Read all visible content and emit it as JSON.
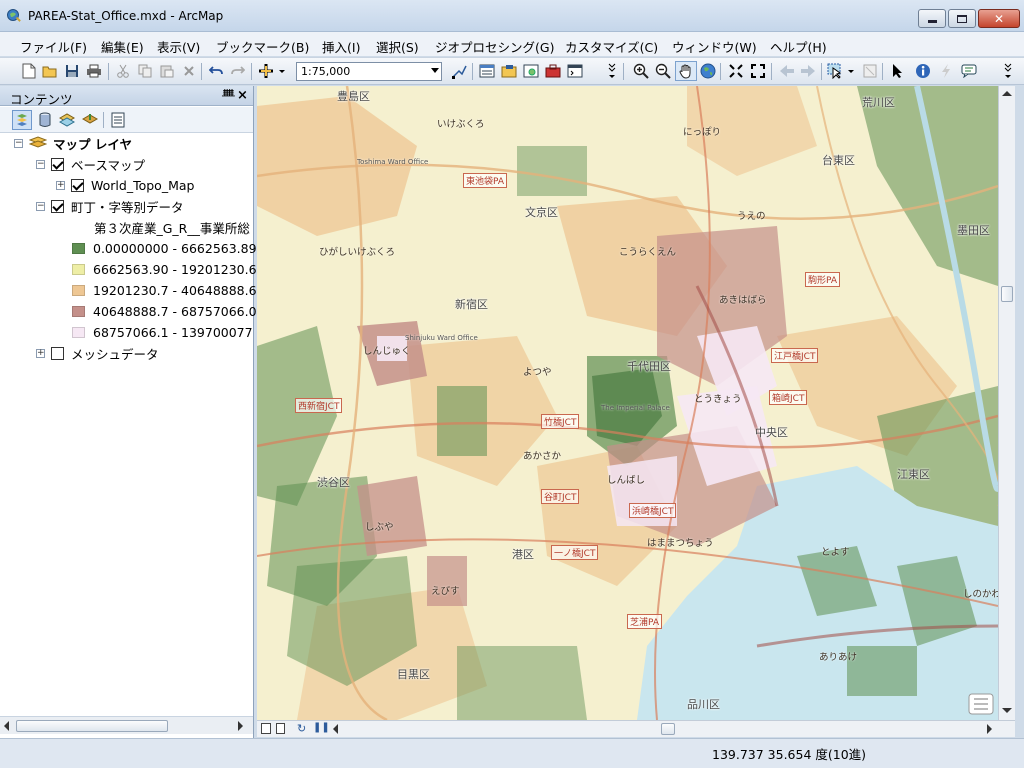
{
  "window": {
    "title": "PAREA-Stat_Office.mxd - ArcMap",
    "min_glyph": "─",
    "max_glyph": "□",
    "close_glyph": "✕"
  },
  "menu": [
    "ファイル(F)",
    "編集(E)",
    "表示(V)",
    "ブックマーク(B)",
    "挿入(I)",
    "選択(S)",
    "ジオプロセシング(G)",
    "カスタマイズ(C)",
    "ウィンドウ(W)",
    "ヘルプ(H)"
  ],
  "toolbar": {
    "scale": "1:75,000"
  },
  "toc": {
    "title": "コンテンツ",
    "pin": "ᚙ",
    "close": "×",
    "root": "マップ レイヤ",
    "basemap_group": "ベースマップ",
    "basemap_layer": "World_Topo_Map",
    "data_layer": "町丁・字等別データ",
    "field": "第３次産業_G_R__事業所総",
    "classes": [
      {
        "label": "0.00000000 - 6662563.89",
        "color": "#5f8f52"
      },
      {
        "label": "6662563.90 - 19201230.6",
        "color": "#eeeea6"
      },
      {
        "label": "19201230.7 - 40648888.6",
        "color": "#eec794"
      },
      {
        "label": "40648888.7 - 68757066.0",
        "color": "#c4908a"
      },
      {
        "label": "68757066.1 - 139700077",
        "color": "#f6e8f4"
      }
    ],
    "mesh_layer": "メッシュデータ"
  },
  "map": {
    "labels": [
      {
        "text": "豊島区",
        "cls": "ml-ward"
      },
      {
        "text": "Toshima Ward Office",
        "cls": "ml-sub"
      },
      {
        "text": "文京区",
        "cls": "ml-ward"
      },
      {
        "text": "荒川区",
        "cls": "ml-ward"
      },
      {
        "text": "台東区",
        "cls": "ml-ward"
      },
      {
        "text": "墨田区",
        "cls": "ml-ward"
      },
      {
        "text": "新宿区",
        "cls": "ml-ward"
      },
      {
        "text": "Shinjuku Ward Office",
        "cls": "ml-sub"
      },
      {
        "text": "千代田区",
        "cls": "ml-ward"
      },
      {
        "text": "中央区",
        "cls": "ml-ward"
      },
      {
        "text": "江東区",
        "cls": "ml-ward"
      },
      {
        "text": "渋谷区",
        "cls": "ml-ward"
      },
      {
        "text": "港区",
        "cls": "ml-ward"
      },
      {
        "text": "目黒区",
        "cls": "ml-ward"
      },
      {
        "text": "品川区",
        "cls": "ml-ward"
      },
      {
        "text": "いけぶくろ",
        "cls": "ml-kana"
      },
      {
        "text": "しんじゅく",
        "cls": "ml-kana"
      },
      {
        "text": "しぶや",
        "cls": "ml-kana"
      },
      {
        "text": "あきはばら",
        "cls": "ml-kana"
      },
      {
        "text": "とうきょう",
        "cls": "ml-kana"
      },
      {
        "text": "うえの",
        "cls": "ml-kana"
      },
      {
        "text": "しんばし",
        "cls": "ml-kana"
      },
      {
        "text": "はままつちょう",
        "cls": "ml-kana"
      },
      {
        "text": "ひがしいけぶくろ",
        "cls": "ml-kana"
      },
      {
        "text": "にっぽり",
        "cls": "ml-kana"
      },
      {
        "text": "こうらくえん",
        "cls": "ml-kana"
      },
      {
        "text": "よつや",
        "cls": "ml-kana"
      },
      {
        "text": "あかさか",
        "cls": "ml-kana"
      },
      {
        "text": "えびす",
        "cls": "ml-kana"
      },
      {
        "text": "とよす",
        "cls": "ml-kana"
      },
      {
        "text": "ありあけ",
        "cls": "ml-kana"
      },
      {
        "text": "しのかわ",
        "cls": "ml-kana"
      },
      {
        "text": "The Imperial Palace",
        "cls": "ml-sub"
      },
      {
        "text": "竹橋JCT",
        "cls": "ml-jct"
      },
      {
        "text": "江戸橋JCT",
        "cls": "ml-jct"
      },
      {
        "text": "箱崎JCT",
        "cls": "ml-jct"
      },
      {
        "text": "西新宿JCT",
        "cls": "ml-jct"
      },
      {
        "text": "谷町JCT",
        "cls": "ml-jct"
      },
      {
        "text": "浜崎橋JCT",
        "cls": "ml-jct"
      },
      {
        "text": "一ノ橋JCT",
        "cls": "ml-jct"
      },
      {
        "text": "東池袋PA",
        "cls": "ml-jct"
      },
      {
        "text": "駒形PA",
        "cls": "ml-jct"
      },
      {
        "text": "芝浦PA",
        "cls": "ml-jct"
      }
    ]
  },
  "status": {
    "coords": "139.737  35.654 度(10進)"
  },
  "colors": {
    "class1": "#5f8f52",
    "class2": "#eeeea6",
    "class3": "#eec794",
    "class4": "#c4908a",
    "class5": "#f6e8f4",
    "water": "#c9e6ee",
    "base": "#f5f0cf"
  }
}
